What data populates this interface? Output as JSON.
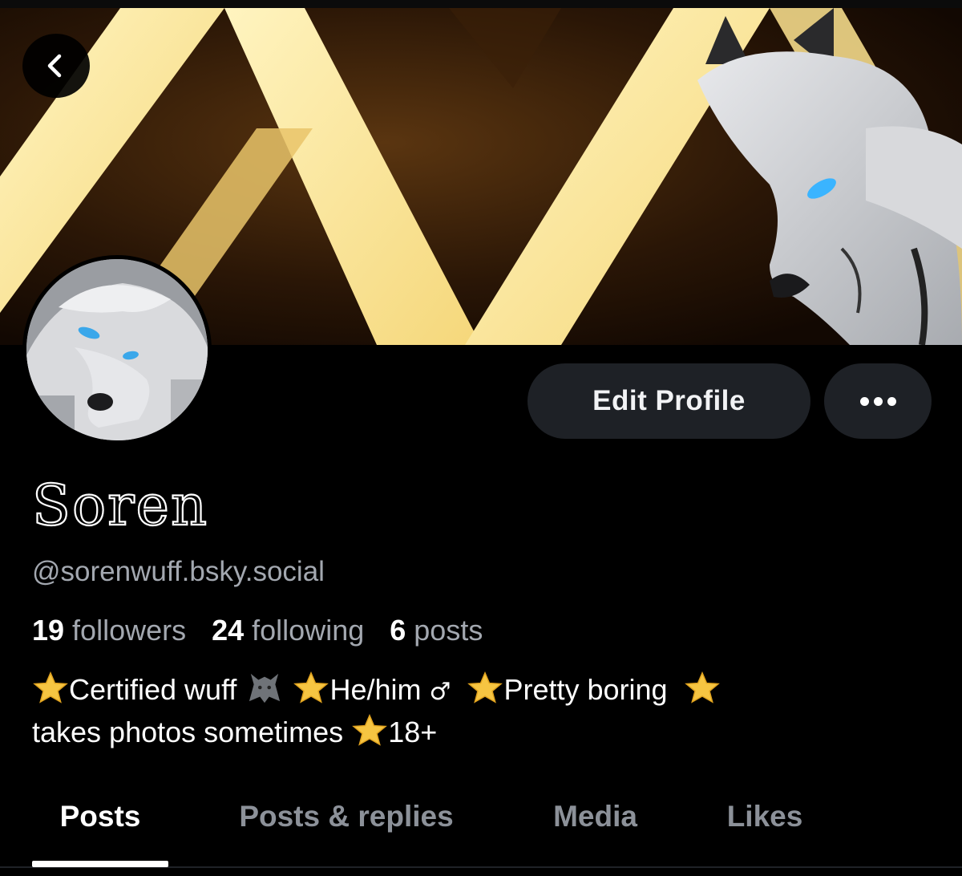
{
  "header": {
    "back_icon": "chevron-left-icon",
    "banner_description": "",
    "edit_profile_label": "Edit Profile",
    "more_icon": "ellipsis-icon"
  },
  "profile": {
    "display_name": "Soren",
    "handle": "@sorenwuff.bsky.social",
    "stats": [
      {
        "count": "19",
        "label": "followers"
      },
      {
        "count": "24",
        "label": "following"
      },
      {
        "count": "6",
        "label": "posts"
      }
    ],
    "bio": {
      "part1": "Certified wuff",
      "part2": "He/him",
      "part3": "♂",
      "part4": "Pretty boring",
      "part5": "takes photos sometimes",
      "part6": "18+"
    }
  },
  "tabs": [
    {
      "label": "Posts",
      "active": true
    },
    {
      "label": "Posts & replies",
      "active": false
    },
    {
      "label": "Media",
      "active": false
    },
    {
      "label": "Likes",
      "active": false
    }
  ],
  "colors": {
    "background": "#000000",
    "button_bg": "#1e2126",
    "muted_text": "#a3a8b0",
    "tab_inactive": "#8c9199",
    "star": "#f6c542"
  }
}
